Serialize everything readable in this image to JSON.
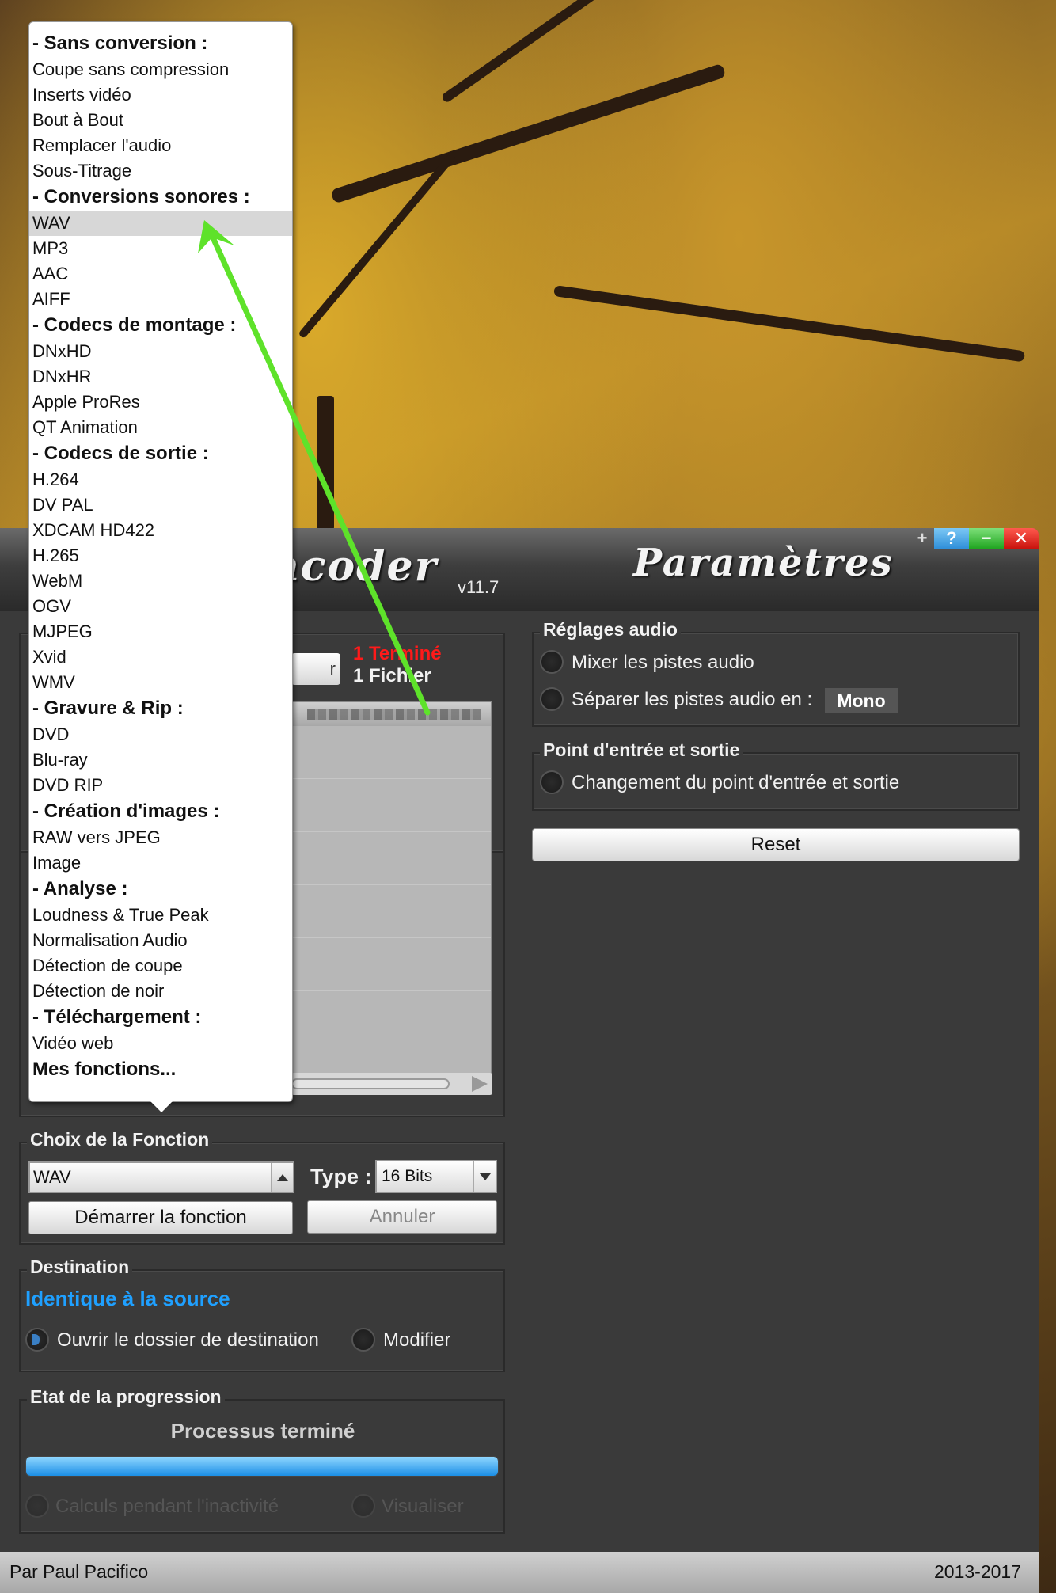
{
  "window": {
    "app_title": "ncoder",
    "version": "v11.7",
    "panel_title": "Paramètres",
    "buttons": {
      "plus": "+",
      "help": "?",
      "min": "−",
      "close": "✕"
    }
  },
  "files": {
    "hidden_button_label": "r",
    "status_done": "1 Terminé",
    "status_files": "1 Fichier"
  },
  "function_choice": {
    "legend": "Choix de la Fonction",
    "value": "WAV",
    "type_label": "Type :",
    "type_value": "16 Bits",
    "start_label": "Démarrer la fonction",
    "cancel_label": "Annuler"
  },
  "destination": {
    "legend": "Destination",
    "path_text": "Identique à la source",
    "open_folder_label": "Ouvrir le dossier de destination",
    "modify_label": "Modifier"
  },
  "progress": {
    "legend": "Etat de la progression",
    "status": "Processus terminé",
    "percent": 100,
    "idle_calc_label": "Calculs pendant l'inactivité",
    "preview_label": "Visualiser"
  },
  "audio_settings": {
    "legend": "Réglages audio",
    "mix_label": "Mixer les pistes audio",
    "split_label": "Séparer les pistes audio en :",
    "split_value": "Mono"
  },
  "inout_point": {
    "legend": "Point d'entrée et sortie",
    "change_label": "Changement du point d'entrée et sortie"
  },
  "reset_label": "Reset",
  "footer": {
    "author": "Par Paul Pacifico",
    "years": "2013-2017"
  },
  "menu": {
    "items": [
      {
        "label": "- Sans conversion :",
        "header": true
      },
      {
        "label": "Coupe sans compression"
      },
      {
        "label": "Inserts vidéo"
      },
      {
        "label": "Bout à Bout"
      },
      {
        "label": "Remplacer l'audio"
      },
      {
        "label": "Sous-Titrage"
      },
      {
        "label": "- Conversions sonores :",
        "header": true
      },
      {
        "label": "WAV",
        "selected": true
      },
      {
        "label": "MP3"
      },
      {
        "label": "AAC"
      },
      {
        "label": "AIFF"
      },
      {
        "label": "- Codecs de montage :",
        "header": true
      },
      {
        "label": "DNxHD"
      },
      {
        "label": "DNxHR"
      },
      {
        "label": "Apple ProRes"
      },
      {
        "label": "QT Animation"
      },
      {
        "label": "- Codecs de sortie :",
        "header": true
      },
      {
        "label": "H.264"
      },
      {
        "label": "DV PAL"
      },
      {
        "label": "XDCAM HD422"
      },
      {
        "label": "H.265"
      },
      {
        "label": "WebM"
      },
      {
        "label": "OGV"
      },
      {
        "label": "MJPEG"
      },
      {
        "label": "Xvid"
      },
      {
        "label": "WMV"
      },
      {
        "label": "- Gravure & Rip :",
        "header": true
      },
      {
        "label": "DVD"
      },
      {
        "label": "Blu-ray"
      },
      {
        "label": "DVD RIP"
      },
      {
        "label": "- Création d'images :",
        "header": true
      },
      {
        "label": "RAW vers JPEG"
      },
      {
        "label": "Image"
      },
      {
        "label": "- Analyse :",
        "header": true
      },
      {
        "label": "Loudness & True Peak"
      },
      {
        "label": "Normalisation Audio"
      },
      {
        "label": "Détection de coupe"
      },
      {
        "label": "Détection de noir"
      },
      {
        "label": "- Téléchargement :",
        "header": true
      },
      {
        "label": "Vidéo web"
      },
      {
        "label": "Mes fonctions...",
        "header": true
      }
    ]
  },
  "colors": {
    "accent_blue": "#1fa0ff",
    "status_red": "#ff1a1a",
    "annotation_arrow": "#5ee22a"
  }
}
